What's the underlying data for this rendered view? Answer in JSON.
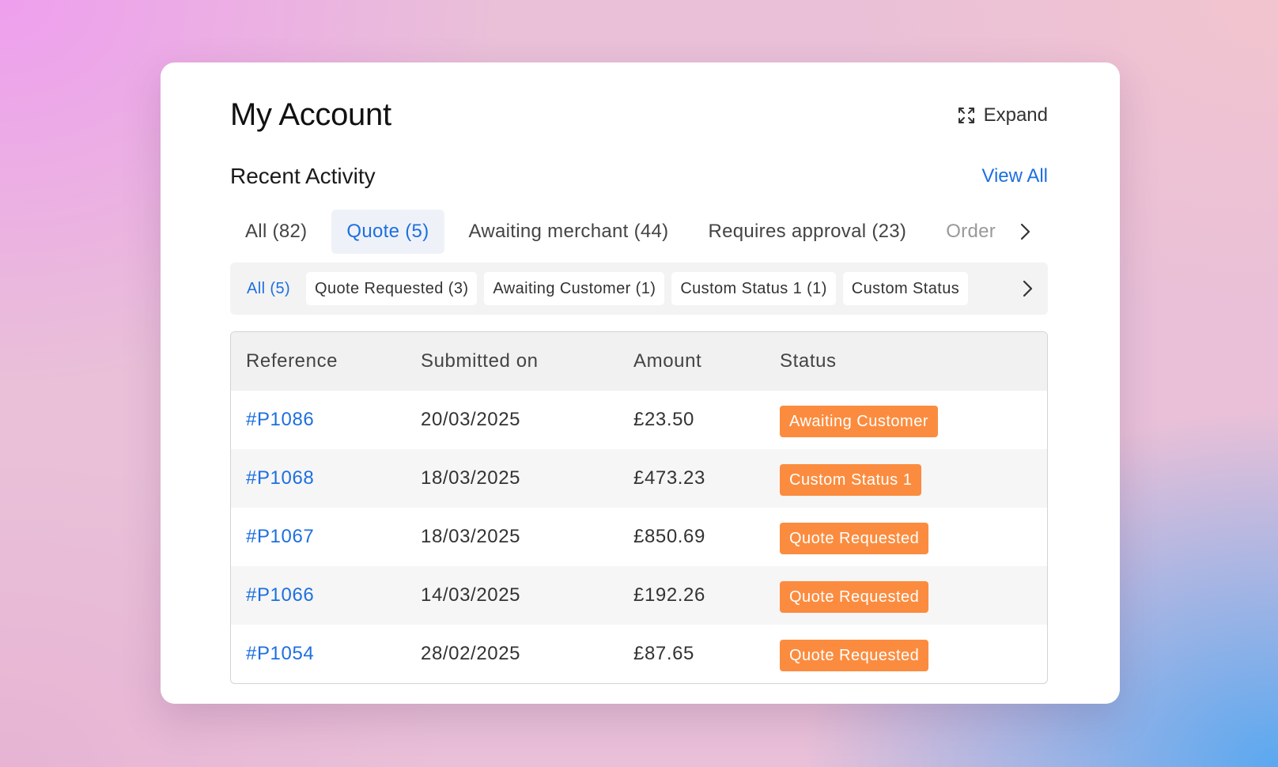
{
  "account": {
    "title": "My Account",
    "expand_label": "Expand"
  },
  "activity": {
    "title": "Recent Activity",
    "view_all_label": "View All"
  },
  "tabs": [
    {
      "label": "All (82)",
      "active": false
    },
    {
      "label": "Quote (5)",
      "active": true
    },
    {
      "label": "Awaiting merchant (44)",
      "active": false
    },
    {
      "label": "Requires approval (23)",
      "active": false
    },
    {
      "label": "Order",
      "active": false
    }
  ],
  "subtabs": [
    {
      "label": "All (5)",
      "active": true
    },
    {
      "label": "Quote Requested (3)",
      "active": false
    },
    {
      "label": "Awaiting Customer (1)",
      "active": false
    },
    {
      "label": "Custom Status 1 (1)",
      "active": false
    },
    {
      "label": "Custom Status",
      "active": false
    }
  ],
  "table": {
    "columns": [
      "Reference",
      "Submitted on",
      "Amount",
      "Status"
    ],
    "rows": [
      {
        "reference": "#P1086",
        "submitted": "20/03/2025",
        "amount": "£23.50",
        "status": "Awaiting Customer"
      },
      {
        "reference": "#P1068",
        "submitted": "18/03/2025",
        "amount": "£473.23",
        "status": "Custom Status 1"
      },
      {
        "reference": "#P1067",
        "submitted": "18/03/2025",
        "amount": "£850.69",
        "status": "Quote Requested"
      },
      {
        "reference": "#P1066",
        "submitted": "14/03/2025",
        "amount": "£192.26",
        "status": "Quote Requested"
      },
      {
        "reference": "#P1054",
        "submitted": "28/02/2025",
        "amount": "£87.65",
        "status": "Quote Requested"
      }
    ]
  },
  "colors": {
    "accent": "#1e6fe0",
    "status_badge": "#fb8c3f"
  },
  "icons": {
    "expand": "expand-icon",
    "scroll_right": "chevron-right-icon"
  }
}
